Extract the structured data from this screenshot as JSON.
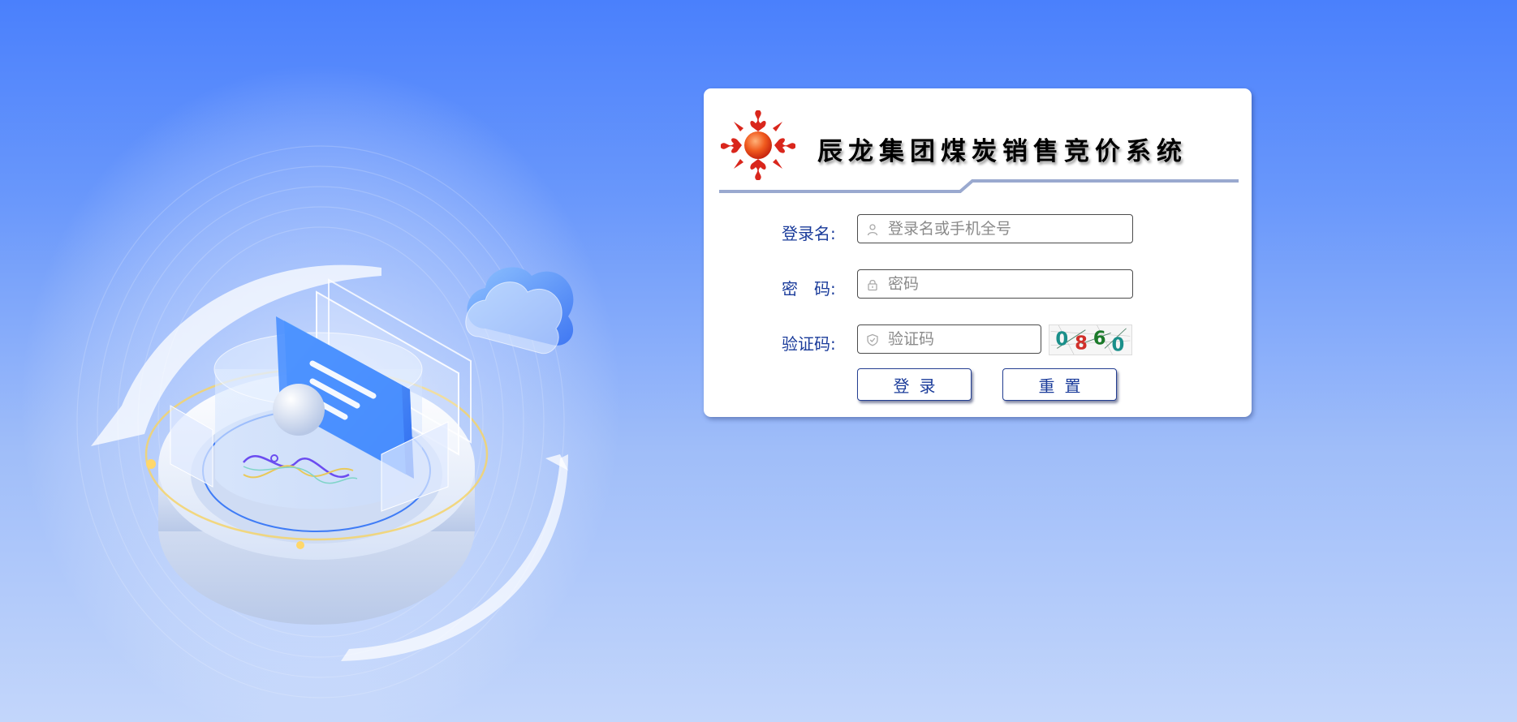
{
  "login": {
    "system_title": "辰龙集团煤炭销售竞价系统",
    "username": {
      "label": "登录名:",
      "placeholder": "登录名或手机全号",
      "value": ""
    },
    "password": {
      "label": "密　码:",
      "placeholder": "密码",
      "value": ""
    },
    "captcha": {
      "label": "验证码:",
      "placeholder": "验证码",
      "value": "",
      "image_chars": [
        "0",
        "8",
        "6",
        "0"
      ],
      "image_char_colors": [
        "#1a8f8a",
        "#d0302a",
        "#1b7a2a",
        "#1a8f8a"
      ]
    },
    "login_button_label": "登录",
    "reset_button_label": "重置"
  },
  "icons": {
    "username_field": "user-icon",
    "password_field": "lock-icon",
    "captcha_field": "shield-icon",
    "logo": "sun-emblem-logo"
  },
  "colors": {
    "background_top": "#4a80fc",
    "background_bottom": "#c3d6fb",
    "label_text": "#1a3b9a",
    "logo_sun": "#e8401c"
  }
}
